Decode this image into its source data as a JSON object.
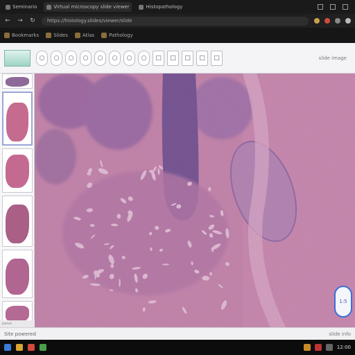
{
  "browser": {
    "tabs": [
      {
        "label": "Seminario"
      },
      {
        "label": "Virtual microscopy slide viewer"
      },
      {
        "label": "Histopathology"
      }
    ],
    "address": "https://histology.slides/viewer/slide",
    "bookmarks": [
      {
        "label": "Bookmarks"
      },
      {
        "label": "Slides"
      },
      {
        "label": "Atlas"
      },
      {
        "label": "Pathology"
      }
    ]
  },
  "viewer": {
    "toolbar_buttons": [
      {
        "icon": "circle-icon"
      },
      {
        "icon": "circle-icon"
      },
      {
        "icon": "circle-icon"
      },
      {
        "icon": "circle-icon"
      },
      {
        "icon": "circle-icon"
      },
      {
        "icon": "circle-icon"
      },
      {
        "icon": "circle-icon"
      },
      {
        "icon": "circle-icon"
      },
      {
        "icon": "rect-icon"
      },
      {
        "icon": "rect-icon"
      },
      {
        "icon": "rect-icon"
      },
      {
        "icon": "rect-icon"
      },
      {
        "icon": "rect-icon"
      }
    ],
    "image_label": "slide image",
    "thumbnails": [
      {
        "label": "",
        "color": "#8e6a99"
      },
      {
        "label": "",
        "color": "#c56b8f"
      },
      {
        "label": "",
        "color": "#c46a90"
      },
      {
        "label": "",
        "color": "#a95f86"
      },
      {
        "label": "",
        "color": "#b16591"
      },
      {
        "label": "",
        "color": "#b46a95"
      }
    ],
    "minimap_label": "1:5",
    "footer_left": "Site powered",
    "footer_right": "slide info",
    "status_left": "panel",
    "tissue_colors": {
      "stroma": "#c98aab",
      "dense": "#9c6b9f",
      "dark": "#6a4e8c",
      "light": "#e6b8ce",
      "pale": "#f2d7e3"
    }
  },
  "taskbar": {
    "clock": "12:00"
  }
}
